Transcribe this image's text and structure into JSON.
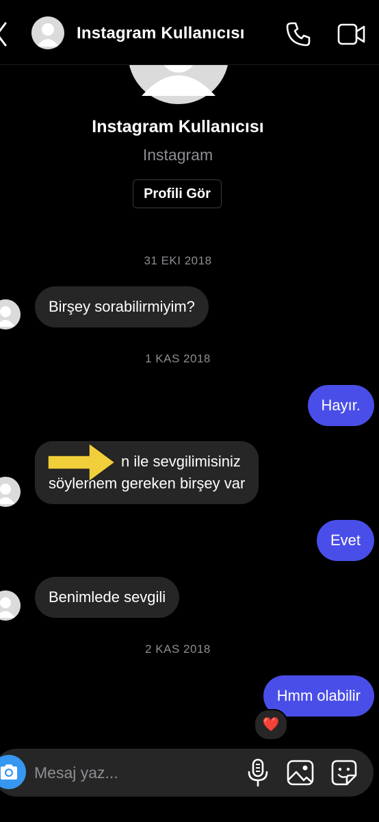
{
  "header": {
    "title": "Instagram Kullanıcısı"
  },
  "profile": {
    "name": "Instagram Kullanıcısı",
    "subtitle": "Instagram",
    "view_profile_label": "Profili Gör"
  },
  "dates": {
    "d1": "31 EKI 2018",
    "d2": "1 KAS 2018",
    "d3": "2 KAS 2018"
  },
  "messages": {
    "m1": "Birşey sorabilirmiyim?",
    "m2": "Hayır.",
    "m3_line1": "n ile sevgilimisiniz",
    "m3_line2": "söylemem gereken birşey var",
    "m4": "Evet",
    "m5": "Benimlede sevgili",
    "m6": "Hmm olabilir",
    "m6_reaction": "❤️"
  },
  "composer": {
    "placeholder": "Mesaj yaz..."
  },
  "colors": {
    "sent_bubble": "#4a4ee8",
    "received_bubble": "#262626",
    "camera_button": "#3797f0",
    "highlight_arrow": "#f0cf3a"
  },
  "icons": {
    "back": "chevron-left-icon",
    "phone": "phone-icon",
    "video": "video-camera-icon",
    "camera": "camera-icon",
    "mic": "microphone-icon",
    "gallery": "image-icon",
    "sticker": "sticker-icon"
  }
}
